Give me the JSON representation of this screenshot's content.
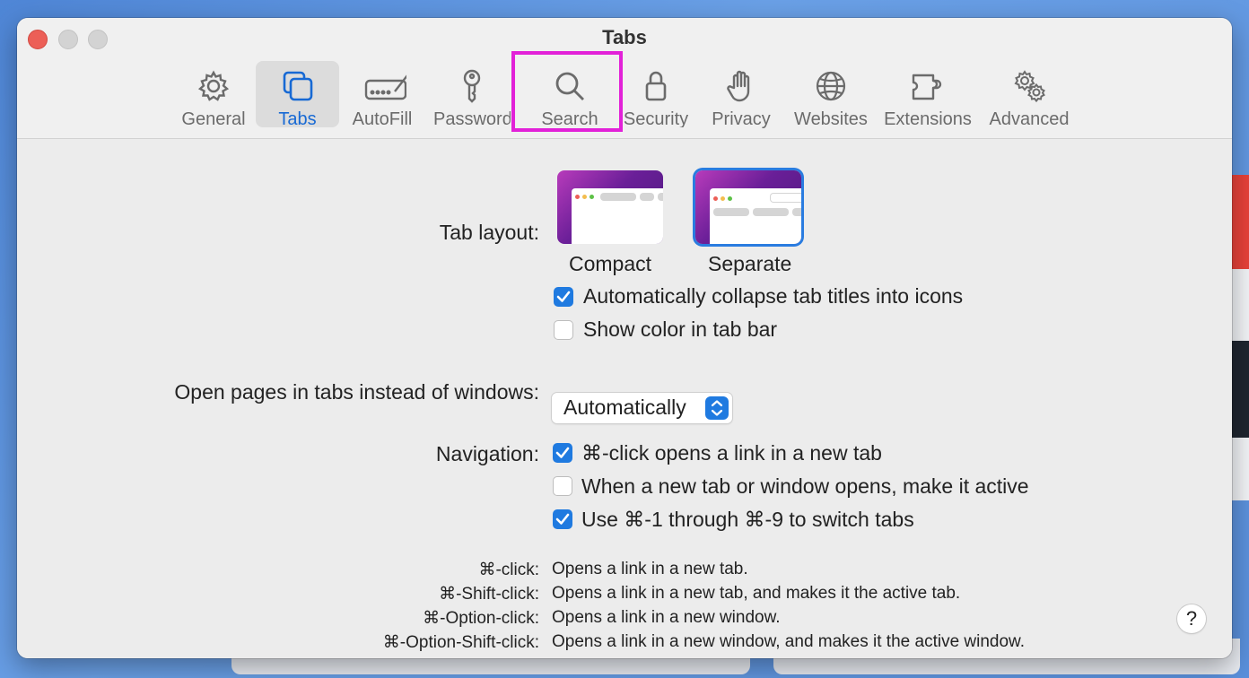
{
  "window": {
    "title": "Tabs"
  },
  "toolbar": [
    {
      "label": "General",
      "icon": "gear-icon"
    },
    {
      "label": "Tabs",
      "icon": "tabs-icon",
      "active": true
    },
    {
      "label": "AutoFill",
      "icon": "autofill-icon"
    },
    {
      "label": "Passwords",
      "icon": "key-icon"
    },
    {
      "label": "Search",
      "icon": "search-icon"
    },
    {
      "label": "Security",
      "icon": "lock-icon"
    },
    {
      "label": "Privacy",
      "icon": "hand-icon"
    },
    {
      "label": "Websites",
      "icon": "globe-icon"
    },
    {
      "label": "Extensions",
      "icon": "puzzle-icon"
    },
    {
      "label": "Advanced",
      "icon": "gears-icon"
    }
  ],
  "tab_layout": {
    "label": "Tab layout:",
    "options": [
      {
        "label": "Compact",
        "selected": false
      },
      {
        "label": "Separate",
        "selected": true
      }
    ],
    "collapse_titles": {
      "label": "Automatically collapse tab titles into icons",
      "checked": true
    },
    "show_color": {
      "label": "Show color in tab bar",
      "checked": false
    }
  },
  "open_pages": {
    "label": "Open pages in tabs instead of windows:",
    "value": "Automatically"
  },
  "navigation": {
    "label": "Navigation:",
    "cmd_click": {
      "label": "⌘-click opens a link in a new tab",
      "checked": true
    },
    "make_active": {
      "label": "When a new tab or window opens, make it active",
      "checked": false
    },
    "cmd_numbers": {
      "label": "Use ⌘-1 through ⌘-9 to switch tabs",
      "checked": true
    }
  },
  "shortcuts": [
    {
      "key": "⌘-click:",
      "desc": "Opens a link in a new tab."
    },
    {
      "key": "⌘-Shift-click:",
      "desc": "Opens a link in a new tab, and makes it the active tab."
    },
    {
      "key": "⌘-Option-click:",
      "desc": "Opens a link in a new window."
    },
    {
      "key": "⌘-Option-Shift-click:",
      "desc": "Opens a link in a new window, and makes it the active window."
    }
  ],
  "help": "?",
  "colors": {
    "accent": "#1f7ae0",
    "highlight": "#e221d8",
    "close": "#ec5f57"
  }
}
